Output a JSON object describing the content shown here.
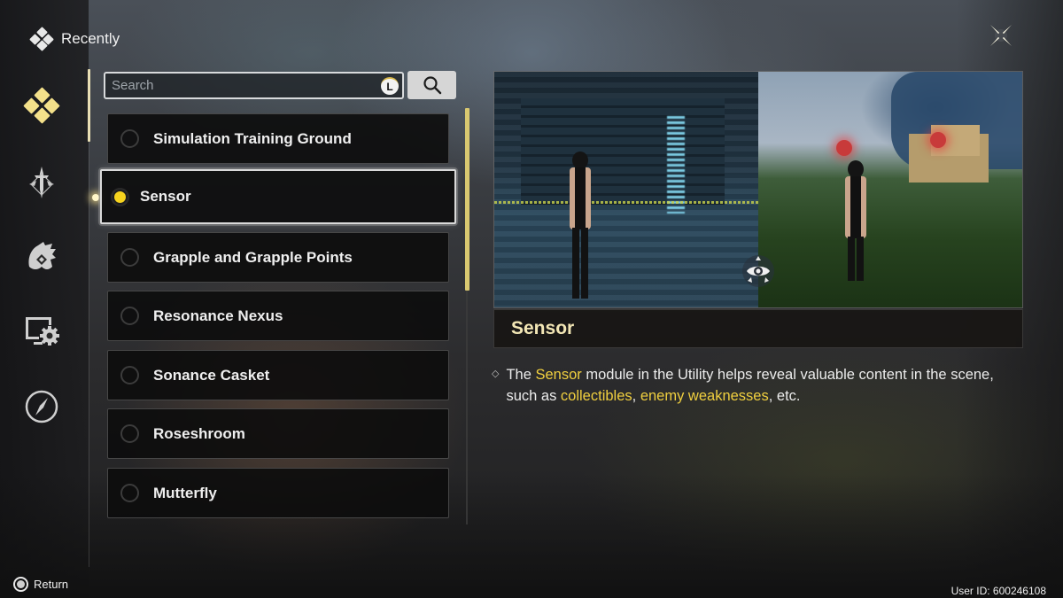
{
  "header": {
    "title": "Recently",
    "icon": "diamond-cluster-icon"
  },
  "close_button": {
    "icon": "close-x-icon"
  },
  "sidebar": {
    "items": [
      {
        "name": "recently",
        "icon": "diamond-cluster-icon",
        "active": true
      },
      {
        "name": "combat",
        "icon": "sword-icon",
        "active": false
      },
      {
        "name": "enemies",
        "icon": "monster-icon",
        "active": false
      },
      {
        "name": "system",
        "icon": "monitor-gear-icon",
        "active": false
      },
      {
        "name": "exploration",
        "icon": "compass-icon",
        "active": false
      }
    ]
  },
  "search": {
    "placeholder": "Search",
    "value": "",
    "key_hint": "L",
    "button_icon": "search-icon"
  },
  "list": {
    "items": [
      {
        "label": "Simulation Training Ground",
        "selected": false
      },
      {
        "label": "Sensor",
        "selected": true
      },
      {
        "label": "Grapple and Grapple Points",
        "selected": false
      },
      {
        "label": "Resonance Nexus",
        "selected": false
      },
      {
        "label": "Sonance Casket",
        "selected": false
      },
      {
        "label": "Roseshroom",
        "selected": false
      },
      {
        "label": "Mutterfly",
        "selected": false
      }
    ],
    "scroll_position": 0.0,
    "scroll_visible_fraction": 0.44
  },
  "detail": {
    "title": "Sensor",
    "description": {
      "parts": [
        {
          "text": "The ",
          "highlight": false
        },
        {
          "text": "Sensor",
          "highlight": true
        },
        {
          "text": " module in the Utility helps reveal valuable content in the scene, such as ",
          "highlight": false
        },
        {
          "text": "collectibles",
          "highlight": true
        },
        {
          "text": ", ",
          "highlight": false
        },
        {
          "text": "enemy weaknesses",
          "highlight": true
        },
        {
          "text": ", etc.",
          "highlight": false
        }
      ]
    },
    "image_alt": "Sensor tutorial illustration: character scanning environment, revealing holographic path and marked collectibles"
  },
  "footer": {
    "return_label": "Return",
    "user_id": "User ID: 600246108"
  },
  "colors": {
    "accent_yellow": "#f0cf3f",
    "title_cream": "#f2e6b5",
    "active_icon": "#f3e08a",
    "scroll_thumb": "#d9c870"
  }
}
